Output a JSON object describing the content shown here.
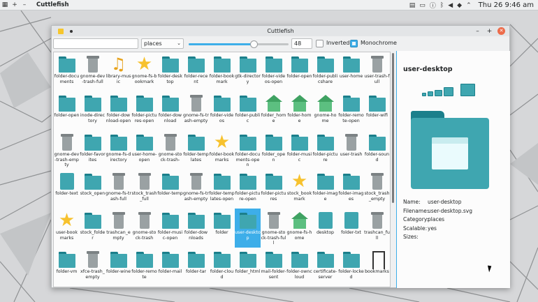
{
  "panel": {
    "app_name": "Cuttlefish",
    "clock": "Thu 26  9:46 am",
    "menu_icon": "app-menu-icon",
    "tray_icons": [
      "window-switcher-icon",
      "battery-icon",
      "info-icon",
      "bluetooth-icon",
      "volume-icon",
      "network-icon",
      "chevron-icon"
    ]
  },
  "window": {
    "title": "Cuttlefish",
    "search_placeholder": "",
    "category": "places",
    "icon_size": "48",
    "slider_fraction": 0.65,
    "inverted_label": "Inverted",
    "inverted_checked": false,
    "monochrome_label": "Monochrome",
    "monochrome_checked": true
  },
  "icons": [
    [
      "folder-documents",
      "gnome-dev-trash-full",
      "library-music",
      "gnome-fs-bookmark",
      "folder-desktop",
      "folder-recent",
      "folder-bookmark",
      "gtk-directory",
      "folder-videos-open",
      "folder-open",
      "folder-publicshare",
      "user-home",
      "user-trash-full"
    ],
    [
      "folder-open",
      "inode-directory",
      "folder-download-open",
      "folder-pictures-open",
      "folder-download",
      "gnome-fs-trash-empty",
      "folder-videos",
      "folder-public",
      "folder_home",
      "folder-home",
      "gnome-home",
      "folder-remote-open",
      "folder-wifi"
    ],
    [
      "gnome-dev-trash-empty",
      "folder-favorites",
      "gnome-fs-directory",
      "user-home-open",
      "gnome-stock-trash-",
      "folder-templates",
      "folder-bookmarks",
      "folder-documents-open",
      "folder_open",
      "folder-music",
      "folder-picture",
      "user-trash",
      "folder-sound"
    ],
    [
      "folder-text",
      "stock_open",
      "gnome-fs-trash-full",
      "stock_trash_full",
      "folder-temp",
      "gnome-fs-trash-empty",
      "folder-templates-open",
      "folder-picture-open",
      "folder-pictures",
      "stock_bookmark",
      "folder-image",
      "folder-images",
      "stock_trash_empty"
    ],
    [
      "user-bookmarks",
      "stock_folder",
      "trashcan_empty",
      "gnome-stock-trash",
      "folder-music-open",
      "folder-downloads",
      "folder",
      "user-desktop",
      "gnome-stock-trash-full",
      "gnome-fs-home",
      "desktop",
      "folder-txt",
      "trashcan_full"
    ],
    [
      "folder-vm",
      "xfce-trash_empty",
      "folder-wine",
      "folder-remote",
      "folder-mail",
      "folder-tar",
      "folder-cloud",
      "folder_html",
      "mail-folder-sent",
      "folder-owncloud",
      "certificate-server",
      "folder-locked",
      "bookmarks"
    ]
  ],
  "icon_types": [
    [
      "folder",
      "trash",
      "note",
      "star",
      "folder",
      "folder",
      "folder",
      "folder",
      "folder",
      "folder",
      "folder",
      "folder",
      "trash"
    ],
    [
      "folder",
      "folder",
      "folder",
      "folder",
      "folder",
      "trash",
      "folder",
      "folder",
      "house",
      "house",
      "house",
      "folder",
      "folder"
    ],
    [
      "trash",
      "folder",
      "folder",
      "folder",
      "trash",
      "folder",
      "star",
      "folder",
      "folder",
      "folder",
      "folder",
      "trash",
      "folder"
    ],
    [
      "page",
      "folder",
      "trash",
      "trash",
      "folder",
      "trash",
      "folder",
      "folder",
      "folder",
      "star",
      "folder",
      "folder",
      "trash"
    ],
    [
      "star",
      "folder",
      "trash",
      "trash",
      "folder",
      "folder",
      "folder",
      "folder",
      "trash",
      "house",
      "page",
      "page",
      "trash"
    ],
    [
      "folder",
      "trash",
      "folder",
      "folder",
      "folder",
      "folder",
      "folder",
      "folder",
      "folder",
      "folder",
      "folder",
      "folder",
      "book"
    ]
  ],
  "selected": "user-desktop",
  "details": {
    "heading": "user-desktop",
    "labels": {
      "name": "Name:",
      "filename": "Filename:",
      "category": "Category:",
      "scalable": "Scalable:",
      "sizes": "Sizes:"
    },
    "name": "user-desktop",
    "filename": "user-desktop.svg",
    "category": "places",
    "scalable": "yes",
    "sizes": ""
  },
  "colors": {
    "accent": "#3daee9",
    "folder": "#3fa6b0",
    "folder_dark": "#1b7f8b",
    "close": "#ed6b4a"
  }
}
